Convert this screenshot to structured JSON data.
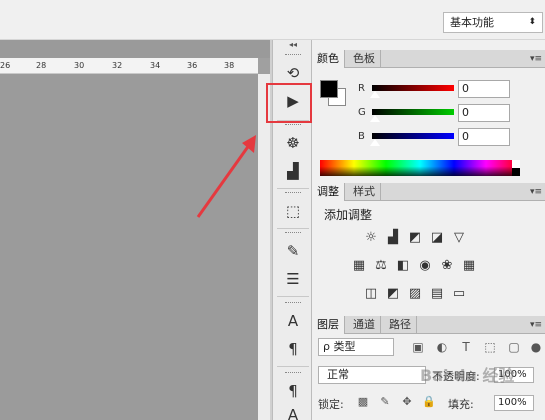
{
  "workspace": {
    "label": "基本功能",
    "arrow": "⬍"
  },
  "ruler": {
    "ticks": [
      "26",
      "28",
      "30",
      "32",
      "34",
      "36",
      "38"
    ]
  },
  "panel_strip": {
    "collapse_glyph": "◂◂"
  },
  "color_panel": {
    "tabs": [
      "颜色",
      "色板"
    ],
    "channels": [
      {
        "label": "R",
        "value": "0",
        "color": "#ff0000"
      },
      {
        "label": "G",
        "value": "0",
        "color": "#00cc00"
      },
      {
        "label": "B",
        "value": "0",
        "color": "#0000ff"
      }
    ],
    "foreground": "#000000",
    "background": "#ffffff"
  },
  "adjustments_panel": {
    "tabs": [
      "调整",
      "样式"
    ],
    "title": "添加调整"
  },
  "layers_panel": {
    "tabs": [
      "图层",
      "通道",
      "路径"
    ],
    "filter_label": "ρ 类型",
    "blend_mode": "正常",
    "opacity_label": "不透明度:",
    "opacity_value": "100%",
    "lock_label": "锁定:",
    "fill_label": "填充:",
    "fill_value": "100%"
  },
  "watermark": "Bai du 经验",
  "colors": {
    "highlight": "#e5393f",
    "arrow": "#e5393f"
  }
}
